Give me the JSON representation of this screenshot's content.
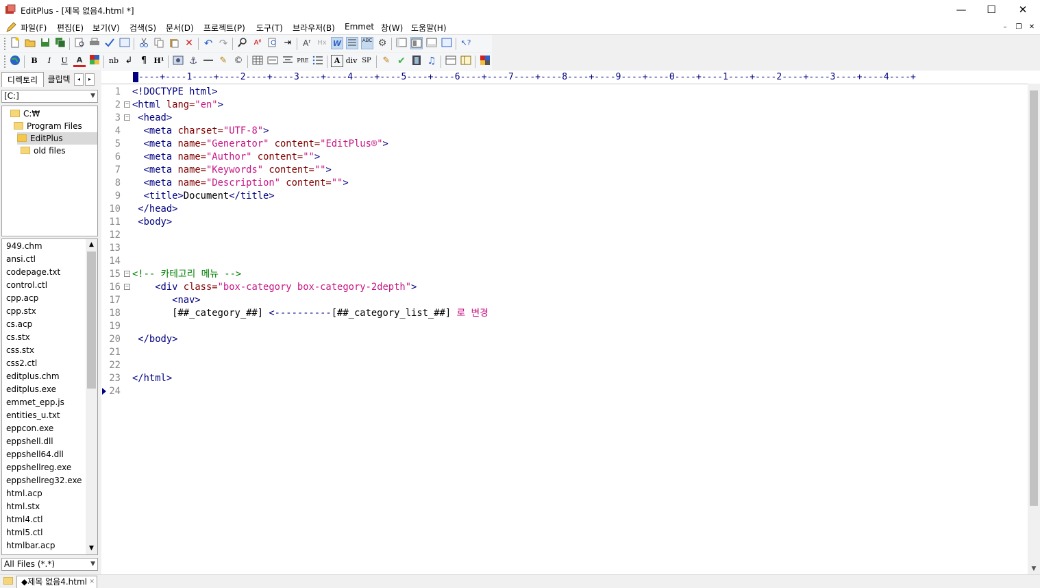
{
  "window": {
    "title": "EditPlus - [제목 없음4.html *]",
    "minimize_glyph": "—",
    "maximize_glyph": "☐",
    "close_glyph": "✕"
  },
  "menu": {
    "items": [
      "파일(F)",
      "편집(E)",
      "보기(V)",
      "검색(S)",
      "문서(D)",
      "프로젝트(P)",
      "도구(T)",
      "브라우저(B)",
      "Emmet",
      "창(W)",
      "도움말(H)"
    ],
    "mdi_min": "–",
    "mdi_restore": "❐",
    "mdi_close": "✕"
  },
  "toolbar2": {
    "bold": "B",
    "italic": "I",
    "underline": "U",
    "font_color": "A",
    "nbsp": "nb",
    "br": "↲",
    "para": "¶",
    "heading": "H¹",
    "pre": "PRE",
    "div": "div",
    "span": "SP"
  },
  "left_panel": {
    "tab_directory": "디렉토리",
    "tab_cliptext": "클립텍",
    "drive": "[C:]",
    "tree": [
      {
        "label": "C:₩",
        "level": 0,
        "selected": false
      },
      {
        "label": "Program Files",
        "level": 1,
        "selected": false
      },
      {
        "label": "EditPlus",
        "level": 2,
        "selected": true
      },
      {
        "label": "old files",
        "level": 3,
        "selected": false
      }
    ],
    "files": [
      "949.chm",
      "ansi.ctl",
      "codepage.txt",
      "control.ctl",
      "cpp.acp",
      "cpp.stx",
      "cs.acp",
      "cs.stx",
      "css.stx",
      "css2.ctl",
      "editplus.chm",
      "editplus.exe",
      "emmet_epp.js",
      "entities_u.txt",
      "eppcon.exe",
      "eppshell.dll",
      "eppshell64.dll",
      "eppshellreg.exe",
      "eppshellreg32.exe",
      "html.acp",
      "html.stx",
      "html4.ctl",
      "html5.ctl",
      "htmlbar.acp"
    ],
    "filter": "All Files (*.*)"
  },
  "editor": {
    "ruler": "----+----1----+----2----+----3----+----4----+----5----+----6----+----7----+----8----+----9----+----0----+----1----+----2----+----3----+----4----+",
    "lines": [
      {
        "n": "1",
        "fold": "",
        "segs": [
          {
            "c": "tag",
            "t": "<!DOCTYPE html>"
          }
        ]
      },
      {
        "n": "2",
        "fold": "⊟",
        "segs": [
          {
            "c": "tag",
            "t": "<html "
          },
          {
            "c": "attr",
            "t": "lang="
          },
          {
            "c": "val",
            "t": "\"en\""
          },
          {
            "c": "tag",
            "t": ">"
          }
        ]
      },
      {
        "n": "3",
        "fold": "⊟",
        "segs": [
          {
            "c": "tag",
            "t": " <head>"
          }
        ]
      },
      {
        "n": "4",
        "fold": "",
        "segs": [
          {
            "c": "tag",
            "t": "  <meta "
          },
          {
            "c": "attr",
            "t": "charset="
          },
          {
            "c": "val",
            "t": "\"UTF-8\""
          },
          {
            "c": "tag",
            "t": ">"
          }
        ]
      },
      {
        "n": "5",
        "fold": "",
        "segs": [
          {
            "c": "tag",
            "t": "  <meta "
          },
          {
            "c": "attr",
            "t": "name="
          },
          {
            "c": "val",
            "t": "\"Generator\""
          },
          {
            "c": "attr",
            "t": " content="
          },
          {
            "c": "val",
            "t": "\"EditPlus®\""
          },
          {
            "c": "tag",
            "t": ">"
          }
        ]
      },
      {
        "n": "6",
        "fold": "",
        "segs": [
          {
            "c": "tag",
            "t": "  <meta "
          },
          {
            "c": "attr",
            "t": "name="
          },
          {
            "c": "val",
            "t": "\"Author\""
          },
          {
            "c": "attr",
            "t": " content="
          },
          {
            "c": "val",
            "t": "\"\""
          },
          {
            "c": "tag",
            "t": ">"
          }
        ]
      },
      {
        "n": "7",
        "fold": "",
        "segs": [
          {
            "c": "tag",
            "t": "  <meta "
          },
          {
            "c": "attr",
            "t": "name="
          },
          {
            "c": "val",
            "t": "\"Keywords\""
          },
          {
            "c": "attr",
            "t": " content="
          },
          {
            "c": "val",
            "t": "\"\""
          },
          {
            "c": "tag",
            "t": ">"
          }
        ]
      },
      {
        "n": "8",
        "fold": "",
        "segs": [
          {
            "c": "tag",
            "t": "  <meta "
          },
          {
            "c": "attr",
            "t": "name="
          },
          {
            "c": "val",
            "t": "\"Description\""
          },
          {
            "c": "attr",
            "t": " content="
          },
          {
            "c": "val",
            "t": "\"\""
          },
          {
            "c": "tag",
            "t": ">"
          }
        ]
      },
      {
        "n": "9",
        "fold": "",
        "segs": [
          {
            "c": "tag",
            "t": "  <title>"
          },
          {
            "c": "plain",
            "t": "Document"
          },
          {
            "c": "tag",
            "t": "</title>"
          }
        ]
      },
      {
        "n": "10",
        "fold": "",
        "segs": [
          {
            "c": "tag",
            "t": " </head>"
          }
        ]
      },
      {
        "n": "11",
        "fold": "",
        "segs": [
          {
            "c": "tag",
            "t": " <body>"
          }
        ]
      },
      {
        "n": "12",
        "fold": "",
        "segs": []
      },
      {
        "n": "13",
        "fold": "",
        "segs": []
      },
      {
        "n": "14",
        "fold": "",
        "segs": []
      },
      {
        "n": "15",
        "fold": "⊟",
        "segs": [
          {
            "c": "cmt",
            "t": "<!-- 카테고리 메뉴 -->"
          }
        ]
      },
      {
        "n": "16",
        "fold": "⊟",
        "segs": [
          {
            "c": "tag",
            "t": "    <div "
          },
          {
            "c": "attr",
            "t": "class="
          },
          {
            "c": "val",
            "t": "\"box-category box-category-2depth\""
          },
          {
            "c": "tag",
            "t": ">"
          }
        ]
      },
      {
        "n": "17",
        "fold": "",
        "segs": [
          {
            "c": "tag",
            "t": "       <nav>"
          }
        ]
      },
      {
        "n": "18",
        "fold": "",
        "segs": [
          {
            "c": "plain",
            "t": "       [##_category_##] "
          },
          {
            "c": "tag",
            "t": "<----------"
          },
          {
            "c": "plain",
            "t": "[##_category_list_##] "
          },
          {
            "c": "val",
            "t": "로 변경"
          }
        ]
      },
      {
        "n": "19",
        "fold": "",
        "segs": []
      },
      {
        "n": "20",
        "fold": "",
        "segs": [
          {
            "c": "tag",
            "t": " </body>"
          }
        ]
      },
      {
        "n": "21",
        "fold": "",
        "segs": []
      },
      {
        "n": "22",
        "fold": "",
        "segs": []
      },
      {
        "n": "23",
        "fold": "",
        "segs": [
          {
            "c": "tag",
            "t": "</html>"
          }
        ]
      },
      {
        "n": "24",
        "fold": "",
        "segs": []
      }
    ]
  },
  "status": {
    "doc_tab": "◆제목 없음4.html"
  }
}
